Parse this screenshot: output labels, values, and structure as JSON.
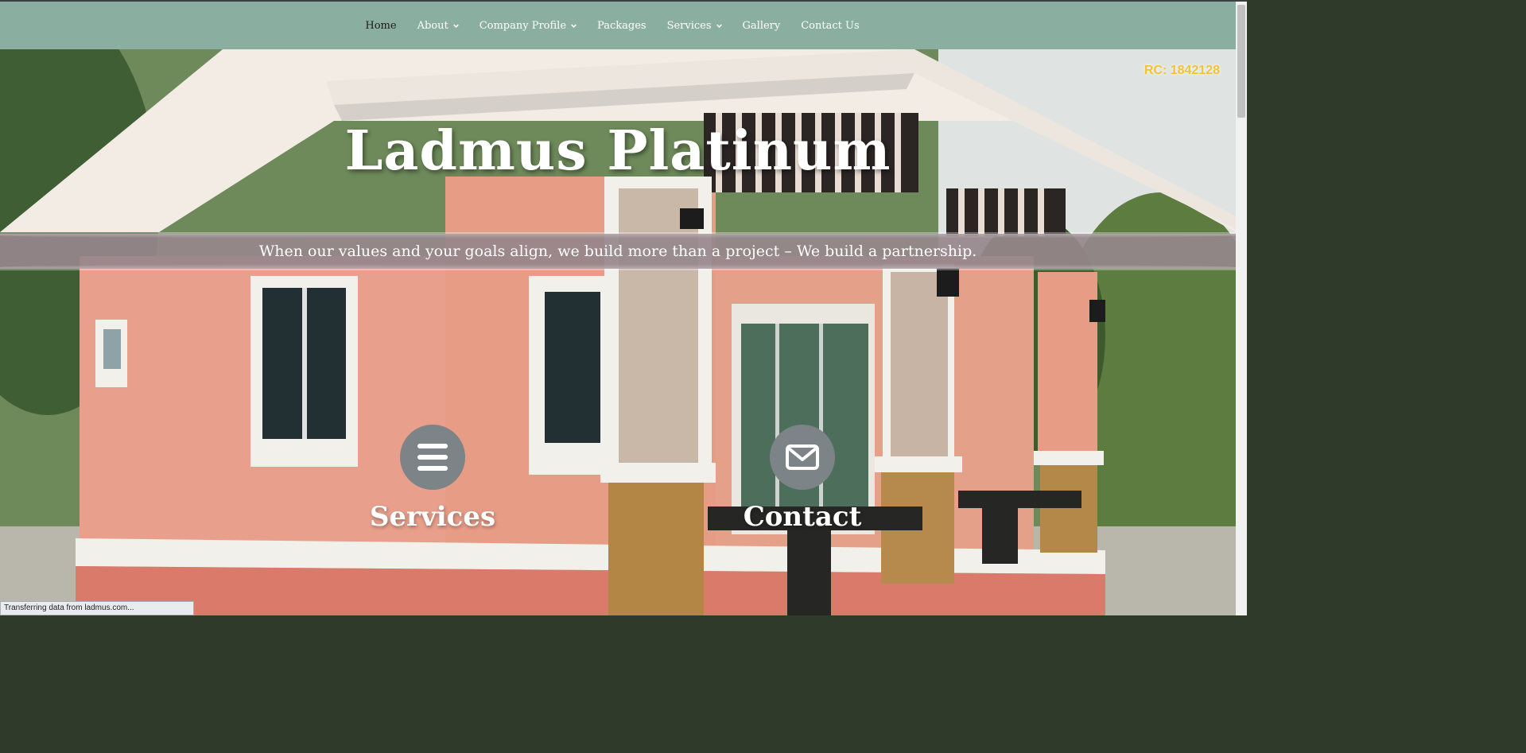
{
  "nav": {
    "items": [
      {
        "label": "Home",
        "active": true,
        "dropdown": false
      },
      {
        "label": "About",
        "active": false,
        "dropdown": true
      },
      {
        "label": "Company Profile",
        "active": false,
        "dropdown": true
      },
      {
        "label": "Packages",
        "active": false,
        "dropdown": false
      },
      {
        "label": "Services",
        "active": false,
        "dropdown": true
      },
      {
        "label": "Gallery",
        "active": false,
        "dropdown": false
      },
      {
        "label": "Contact Us",
        "active": false,
        "dropdown": false
      }
    ]
  },
  "hero": {
    "rc_number": "RC: 1842128",
    "title": "Ladmus Platinum",
    "tagline": "When our values and your goals align, we build more than a project – We build a partnership.",
    "features": [
      {
        "label": "Services",
        "icon": "menu-icon"
      },
      {
        "label": "Contact",
        "icon": "envelope-icon"
      }
    ]
  },
  "status_bar": {
    "text": "Transferring data from ladmus.com..."
  },
  "colors": {
    "nav_bg": "#8aafa0",
    "rc_badge": "#f4c430",
    "tagline_band": "#96878c",
    "feature_circle": "#7c8488"
  }
}
